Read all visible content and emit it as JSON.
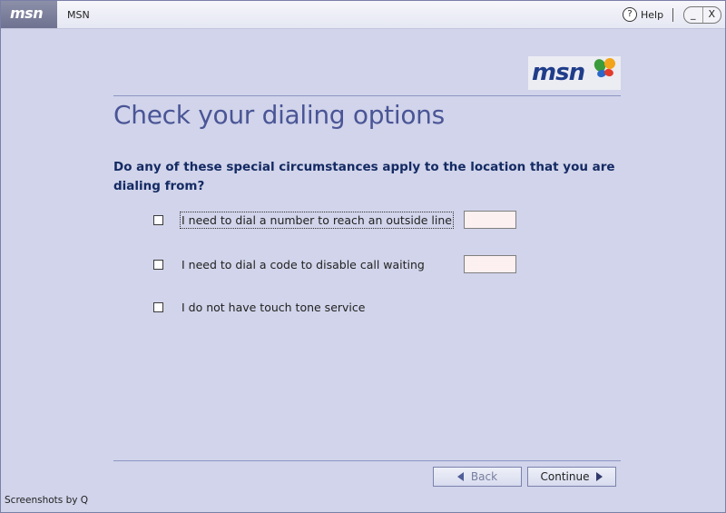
{
  "titlebar": {
    "logo": "msn",
    "title": "MSN",
    "help_label": "Help",
    "help_icon": "?",
    "minimize_icon": "_",
    "close_icon": "X"
  },
  "header": {
    "logo_text": "msn"
  },
  "page": {
    "heading": "Check your dialing options",
    "question": "Do any of these special circumstances apply to the location that you are dialing from?"
  },
  "options": [
    {
      "label": "I need to dial a number to reach an outside line",
      "checked": false,
      "input_value": ""
    },
    {
      "label": "I need to dial a code to disable call waiting",
      "checked": false,
      "input_value": ""
    },
    {
      "label": "I do not have touch tone service",
      "checked": false
    }
  ],
  "buttons": {
    "back": "Back",
    "continue": "Continue"
  },
  "footer": {
    "credit": "Screenshots by Q"
  },
  "colors": {
    "background": "#d1d4ea",
    "heading": "#4a5596",
    "question": "#142a63",
    "input_bg": "#fdf0f0"
  }
}
